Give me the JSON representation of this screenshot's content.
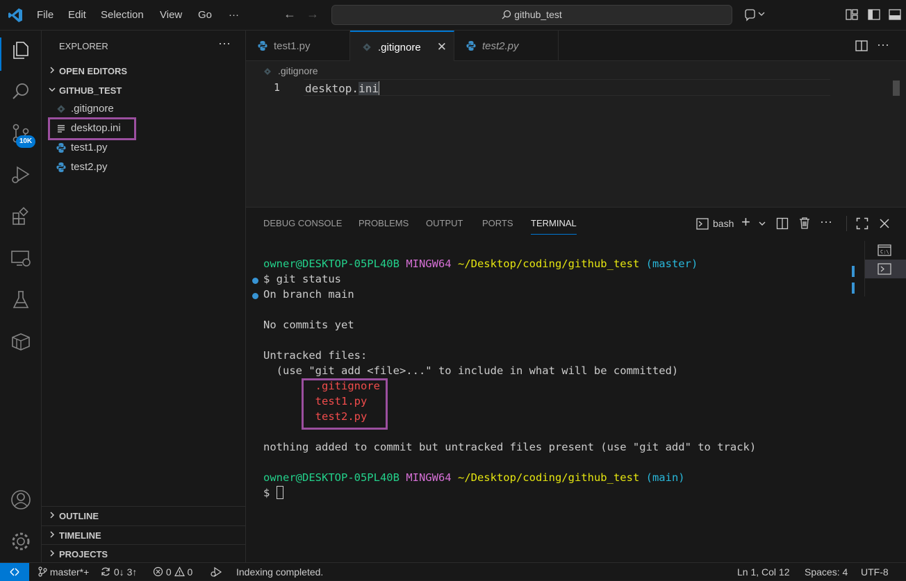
{
  "titlebar": {
    "menus": [
      "File",
      "Edit",
      "Selection",
      "View",
      "Go",
      "···"
    ],
    "search": "github_test"
  },
  "activity": {
    "scm_badge": "10K"
  },
  "sidebar": {
    "title": "EXPLORER",
    "open_editors": "OPEN EDITORS",
    "folder": "GITHUB_TEST",
    "files": [
      ".gitignore",
      "desktop.ini",
      "test1.py",
      "test2.py"
    ],
    "outline": "OUTLINE",
    "timeline": "TIMELINE",
    "projects": "PROJECTS"
  },
  "tabs": [
    {
      "label": "test1.py"
    },
    {
      "label": ".gitignore"
    },
    {
      "label": "test2.py"
    }
  ],
  "editor": {
    "breadcrumb": ".gitignore",
    "line_number": "1",
    "code_prefix": "desktop.",
    "code_selected": "ini"
  },
  "panel": {
    "tabs": [
      "DEBUG CONSOLE",
      "PROBLEMS",
      "OUTPUT",
      "PORTS",
      "TERMINAL"
    ],
    "shell": "bash"
  },
  "terminal": {
    "user": "owner@DESKTOP-05PL40B",
    "env": "MINGW64",
    "path": "~/Desktop/coding/github_test",
    "branch1": "(master)",
    "cmd": "$ git status",
    "line_branch": "On branch main",
    "line_nocommits": "No commits yet",
    "line_untracked": "Untracked files:",
    "line_hint": "  (use \"git add <file>...\" to include in what will be committed)",
    "untracked": [
      ".gitignore",
      "test1.py",
      "test2.py"
    ],
    "line_nothing": "nothing added to commit but untracked files present (use \"git add\" to track)",
    "branch2": "(main)",
    "prompt": "$ "
  },
  "status": {
    "branch": "master*+",
    "sync": "0↓ 3↑",
    "errors": "0",
    "warnings": "0",
    "message": "Indexing completed.",
    "position": "Ln 1, Col 12",
    "spaces": "Spaces: 4",
    "encoding": "UTF-8"
  },
  "colors": {
    "accent": "#0078d4",
    "highlight_box": "#9b4f9f",
    "term_green": "#23d18b",
    "term_magenta": "#d670d6",
    "term_yellow": "#e5e510",
    "term_cyan": "#29b8db",
    "term_red": "#f14c4c"
  }
}
